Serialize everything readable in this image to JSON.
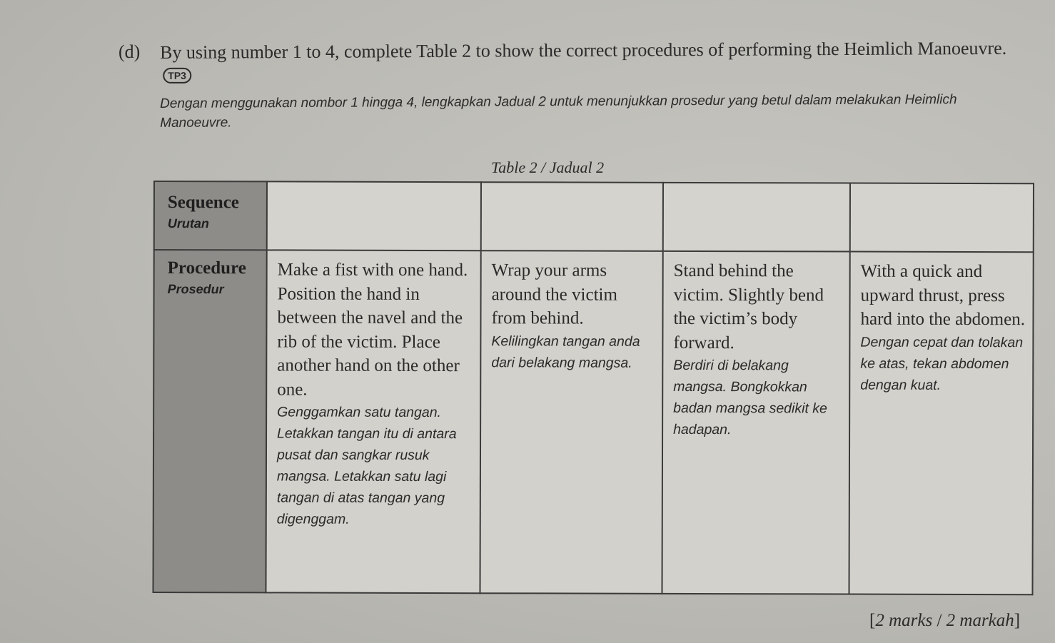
{
  "question": {
    "label": "(d)",
    "text_en": "By using number 1 to 4, complete Table 2 to show the correct procedures of performing the Heimlich Manoeuvre.",
    "badge": "TP3",
    "text_ms": "Dengan menggunakan nombor 1 hingga 4, lengkapkan Jadual 2 untuk menunjukkan prosedur yang betul dalam melakukan Heimlich Manoeuvre."
  },
  "table": {
    "caption": "Table 2 / Jadual 2",
    "row_headers": {
      "sequence": {
        "en": "Sequence",
        "ms": "Urutan"
      },
      "procedure": {
        "en": "Procedure",
        "ms": "Prosedur"
      }
    },
    "sequence_answers": [
      "",
      "",
      "",
      ""
    ],
    "procedures": [
      {
        "en": "Make a fist with one hand. Position the hand in between the navel and the rib of the victim. Place another hand on the other one.",
        "ms": "Genggamkan satu tangan. Letakkan tangan itu di antara pusat dan sangkar rusuk mangsa. Letakkan satu lagi tangan di atas tangan yang digenggam."
      },
      {
        "en": "Wrap your arms around the victim from behind.",
        "ms": "Kelilingkan tangan anda dari belakang mangsa."
      },
      {
        "en": "Stand behind the victim. Slightly bend the victim’s body forward.",
        "ms": "Berdiri di belakang mangsa. Bongkokkan badan mangsa sedikit ke hadapan."
      },
      {
        "en": "With a quick and upward thrust, press hard into the abdomen.",
        "ms": "Dengan cepat dan tolakan ke atas, tekan abdomen dengan kuat."
      }
    ]
  },
  "marks": {
    "open": "[",
    "en": "2 marks",
    "sep": " / ",
    "ms": "2 markah",
    "close": "]"
  }
}
